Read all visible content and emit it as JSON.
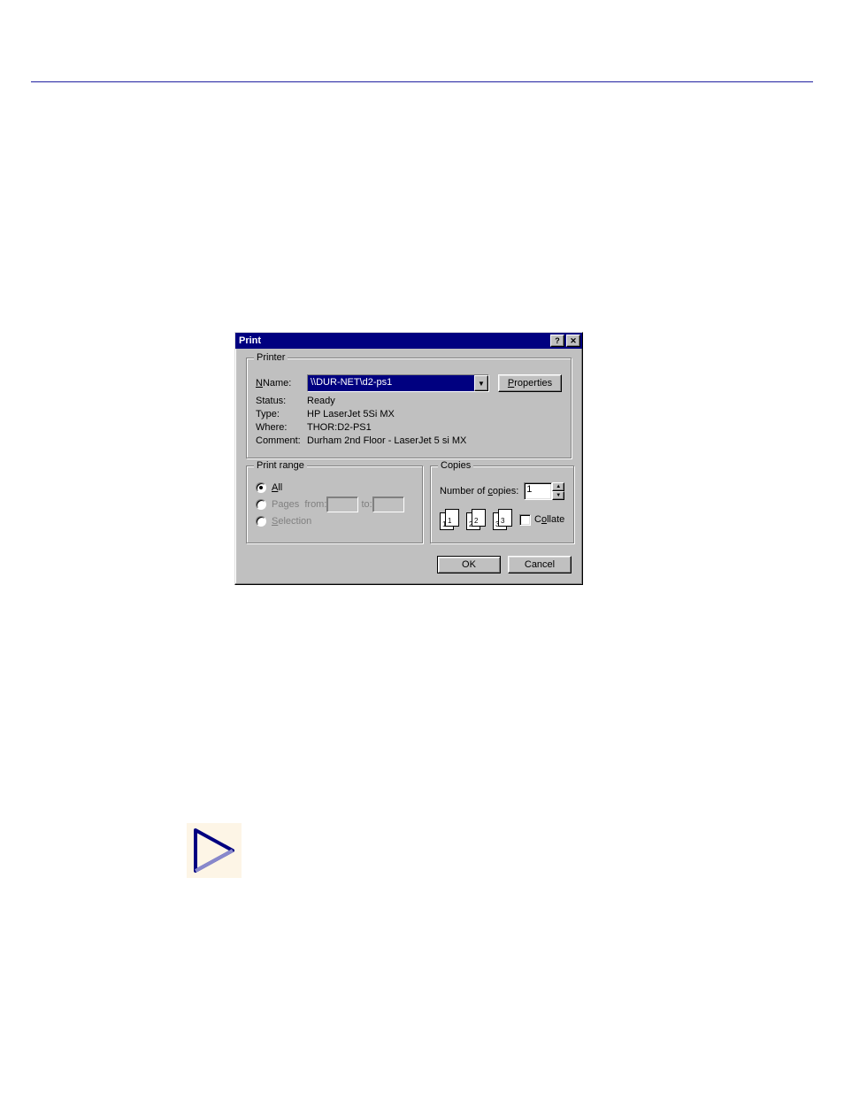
{
  "dialog": {
    "title": "Print",
    "help_glyph": "?",
    "close_glyph": "✕",
    "printer_group": {
      "legend": "Printer",
      "name_label": "Name:",
      "name_value": "\\\\DUR-NET\\d2-ps1",
      "properties_btn": "Properties",
      "status_label": "Status:",
      "status_value": "Ready",
      "type_label": "Type:",
      "type_value": "HP LaserJet 5Si MX",
      "where_label": "Where:",
      "where_value": "THOR:D2-PS1",
      "comment_label": "Comment:",
      "comment_value": "Durham 2nd Floor - LaserJet 5 si MX"
    },
    "range_group": {
      "legend": "Print range",
      "all_label": "All",
      "pages_label": "Pages",
      "from_label": "from:",
      "to_label": "to:",
      "selection_label": "Selection"
    },
    "copies_group": {
      "legend": "Copies",
      "num_label": "Number of copies:",
      "num_value": "1",
      "collate_label": "Collate",
      "page1": "1",
      "page2": "2",
      "page3": "3"
    },
    "ok_btn": "OK",
    "cancel_btn": "Cancel"
  }
}
